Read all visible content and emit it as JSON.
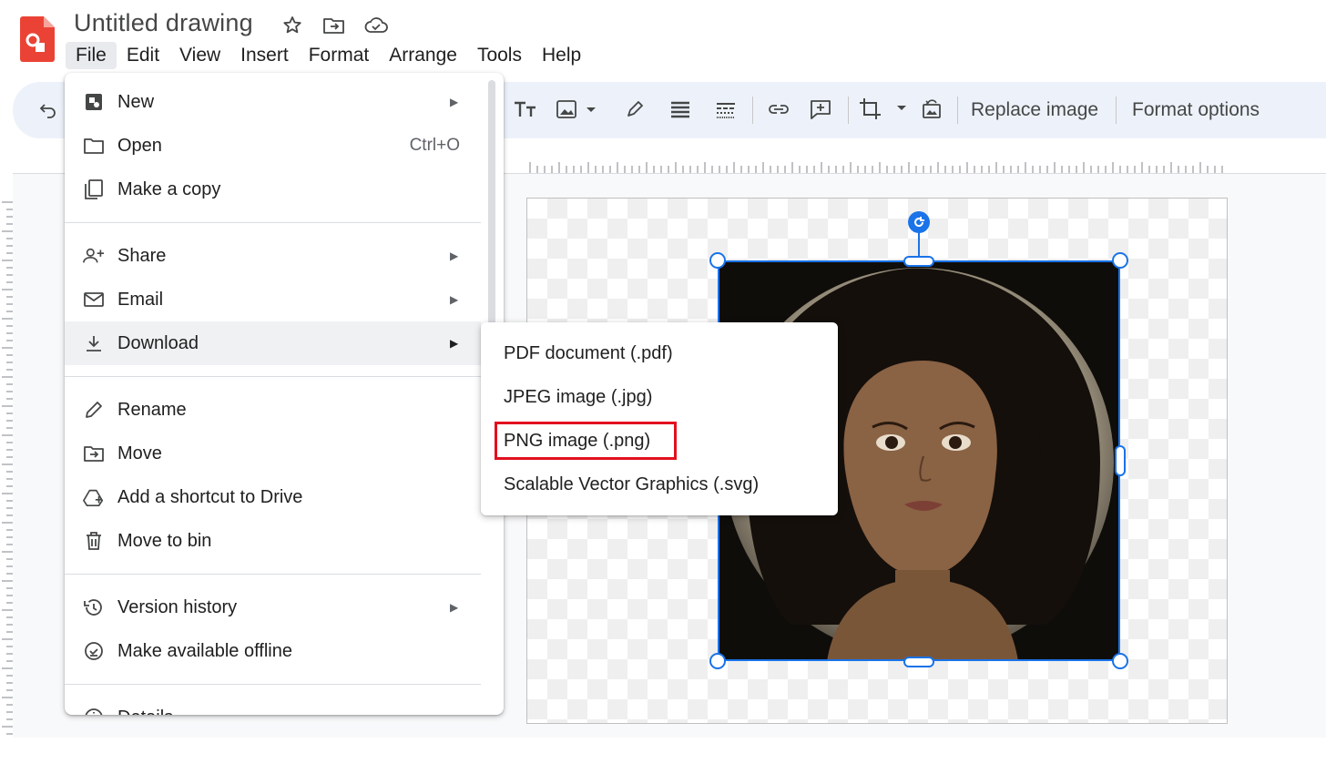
{
  "app": {
    "title": "Untitled drawing",
    "logo_icon": "google-drawings-logo",
    "title_icons": [
      "star-icon",
      "move-to-folder-icon",
      "cloud-saved-icon"
    ]
  },
  "menubar": {
    "items": [
      "File",
      "Edit",
      "View",
      "Insert",
      "Format",
      "Arrange",
      "Tools",
      "Help"
    ],
    "active": "File"
  },
  "toolbar": {
    "replace_image": "Replace image",
    "format_options": "Format options",
    "icons": [
      "undo-icon",
      "text-size-icon",
      "image-icon",
      "pen-icon",
      "line-weight-icon",
      "line-dash-icon",
      "link-icon",
      "add-comment-icon",
      "crop-icon",
      "reset-image-icon"
    ]
  },
  "file_menu": {
    "items": [
      {
        "label": "New",
        "icon": "new-icon",
        "has_submenu": true
      },
      {
        "label": "Open",
        "icon": "folder-icon",
        "shortcut": "Ctrl+O"
      },
      {
        "label": "Make a copy",
        "icon": "copy-icon"
      },
      {
        "label": "Share",
        "icon": "share-person-icon",
        "has_submenu": true
      },
      {
        "label": "Email",
        "icon": "email-icon",
        "has_submenu": true
      },
      {
        "label": "Download",
        "icon": "download-icon",
        "has_submenu": true,
        "hovered": true
      },
      {
        "label": "Rename",
        "icon": "pencil-icon"
      },
      {
        "label": "Move",
        "icon": "move-folder-icon"
      },
      {
        "label": "Add a shortcut to Drive",
        "icon": "drive-shortcut-icon"
      },
      {
        "label": "Move to bin",
        "icon": "trash-icon"
      },
      {
        "label": "Version history",
        "icon": "history-icon",
        "has_submenu": true
      },
      {
        "label": "Make available offline",
        "icon": "offline-check-icon"
      },
      {
        "label": "Details",
        "icon": "info-icon"
      }
    ]
  },
  "download_submenu": {
    "items": [
      {
        "label": "PDF document (.pdf)"
      },
      {
        "label": "JPEG image (.jpg)"
      },
      {
        "label": "PNG image (.png)",
        "highlighted": true
      },
      {
        "label": "Scalable Vector Graphics (.svg)"
      }
    ]
  },
  "colors": {
    "accent": "#1a73e8",
    "highlight": "#e2101e",
    "toolbar_bg": "#edf2fa",
    "logo": "#ea4335"
  }
}
